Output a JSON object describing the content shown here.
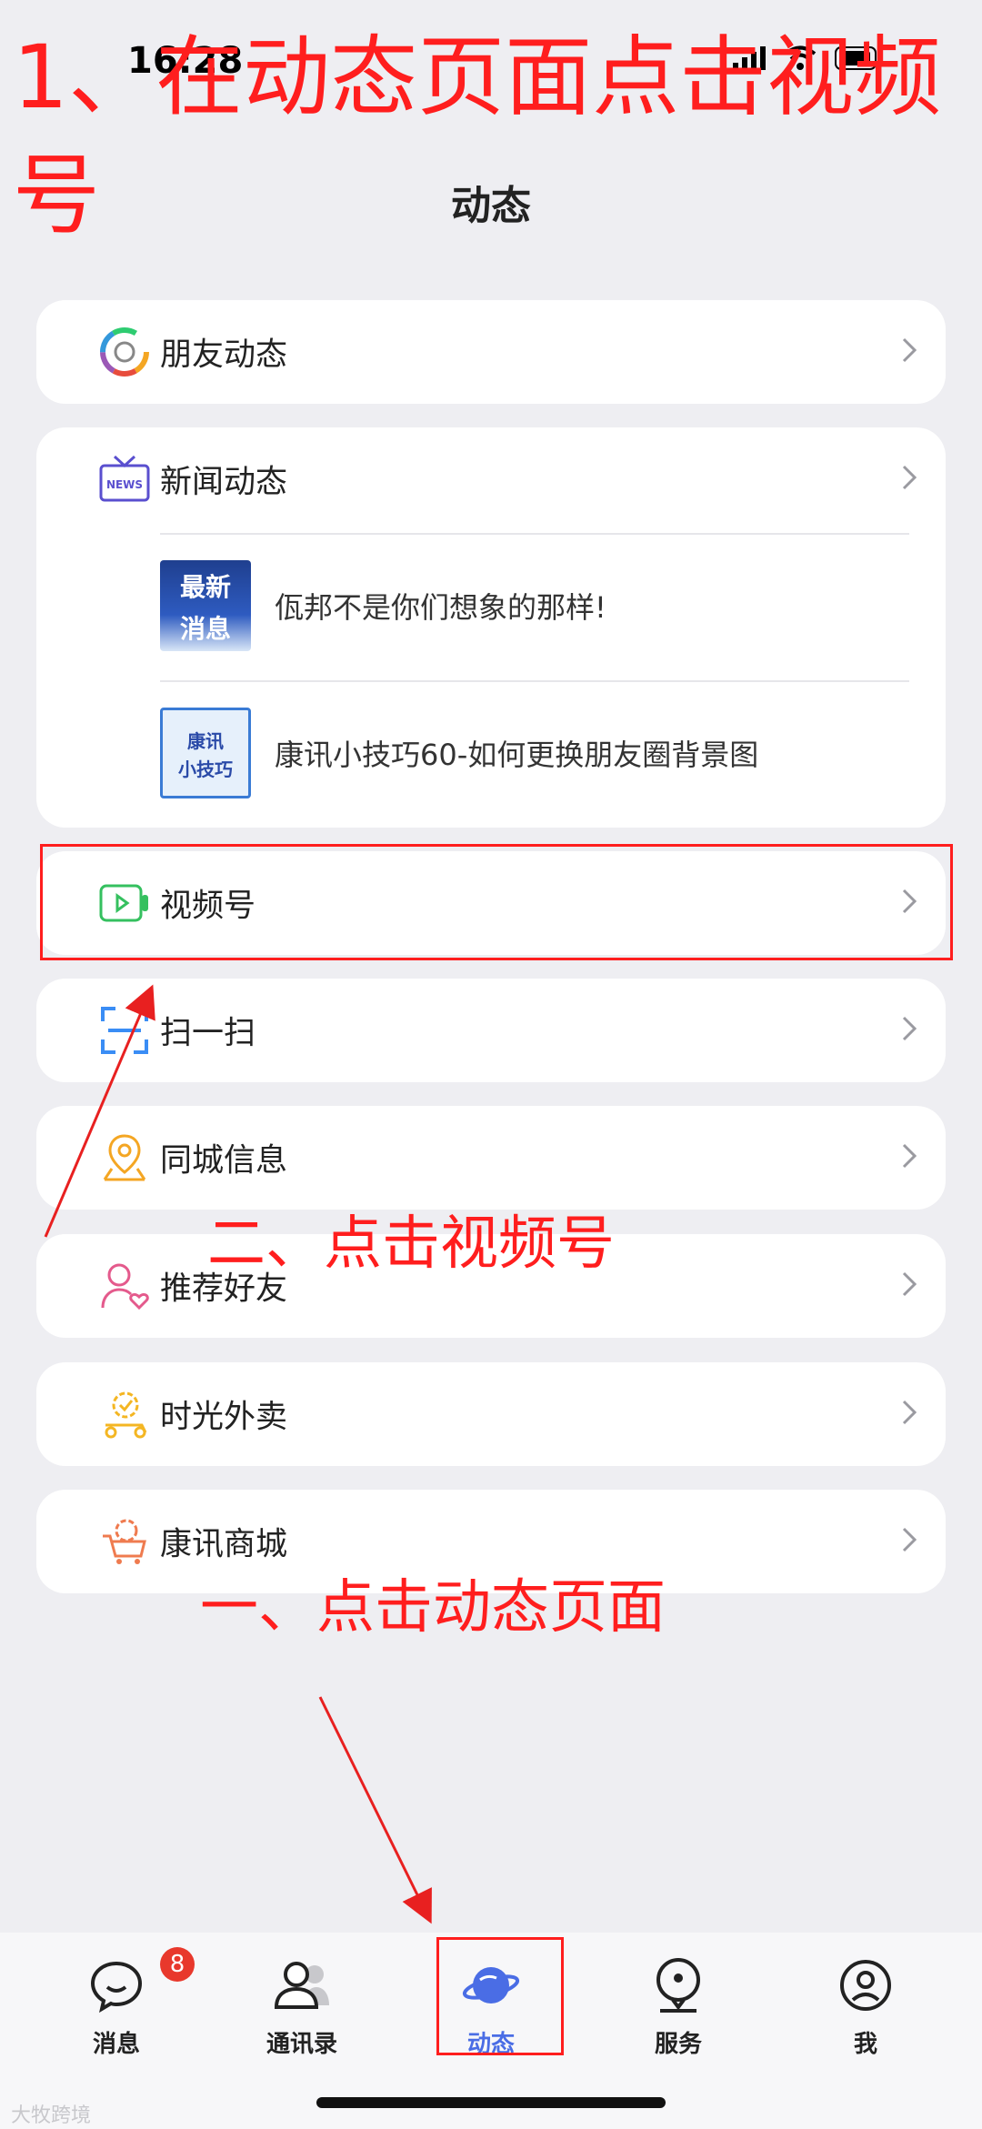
{
  "status_bar": {
    "time": "16:28"
  },
  "header": {
    "title": "动态"
  },
  "menu": {
    "friends": "朋友动态",
    "news": "新闻动态",
    "channels": "视频号",
    "scan": "扫一扫",
    "local_info": "同城信息",
    "recommend_friends": "推荐好友",
    "food_delivery": "时光外卖",
    "mall": "康讯商城"
  },
  "news_items": [
    {
      "thumb_text_top": "最新",
      "thumb_text_bottom": "消息",
      "title": "佤邦不是你们想象的那样!"
    },
    {
      "thumb_text_top": "康讯",
      "thumb_text_bottom": "小技巧",
      "title": "康讯小技巧60-如何更换朋友圈背景图"
    }
  ],
  "annotations": {
    "step_title_line1": "1、在动态页面点击视频",
    "step_title_line2": "号",
    "step_two": "二、点击视频号",
    "step_one": "一、点击动态页面"
  },
  "tabbar": {
    "messages": "消息",
    "messages_badge": "8",
    "contacts": "通讯录",
    "moments": "动态",
    "services": "服务",
    "me": "我"
  },
  "watermark": "大牧跨境",
  "colors": {
    "annotation_red": "#ff1e1e",
    "active_tab": "#4a6de5",
    "badge": "#e8382c"
  }
}
